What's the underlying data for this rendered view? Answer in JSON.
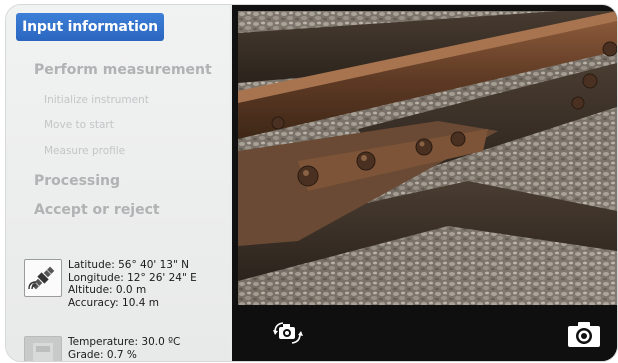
{
  "sidebar": {
    "steps": [
      {
        "label": "Input information",
        "state": "active"
      },
      {
        "label": "Perform measurement",
        "state": "inactive"
      },
      {
        "label": "Initialize instrument",
        "state": "inactive"
      },
      {
        "label": "Move to start",
        "state": "inactive"
      },
      {
        "label": "Measure profile",
        "state": "inactive"
      },
      {
        "label": "Processing",
        "state": "inactive"
      },
      {
        "label": "Accept or reject",
        "state": "inactive"
      }
    ]
  },
  "gps": {
    "icon": "satellite-icon",
    "latitude": "Latitude: 56° 40' 13\" N",
    "longitude": "Longitude: 12° 26' 24\" E",
    "altitude": "Altitude: 0.0 m",
    "accuracy": "Accuracy: 10.4 m"
  },
  "sensor": {
    "icon": "sensor-icon",
    "temperature": "Temperature: 30.0 ºC",
    "grade": "Grade: 0.7 %"
  },
  "camera": {
    "rotate_icon": "rotate-camera-icon",
    "capture_icon": "camera-icon"
  },
  "colors": {
    "active_step": "#2a66bf",
    "inactive_text": "#b0b2b3",
    "sidebar_bg": "#ececec",
    "toolbar_bg": "#0f0f0f"
  }
}
